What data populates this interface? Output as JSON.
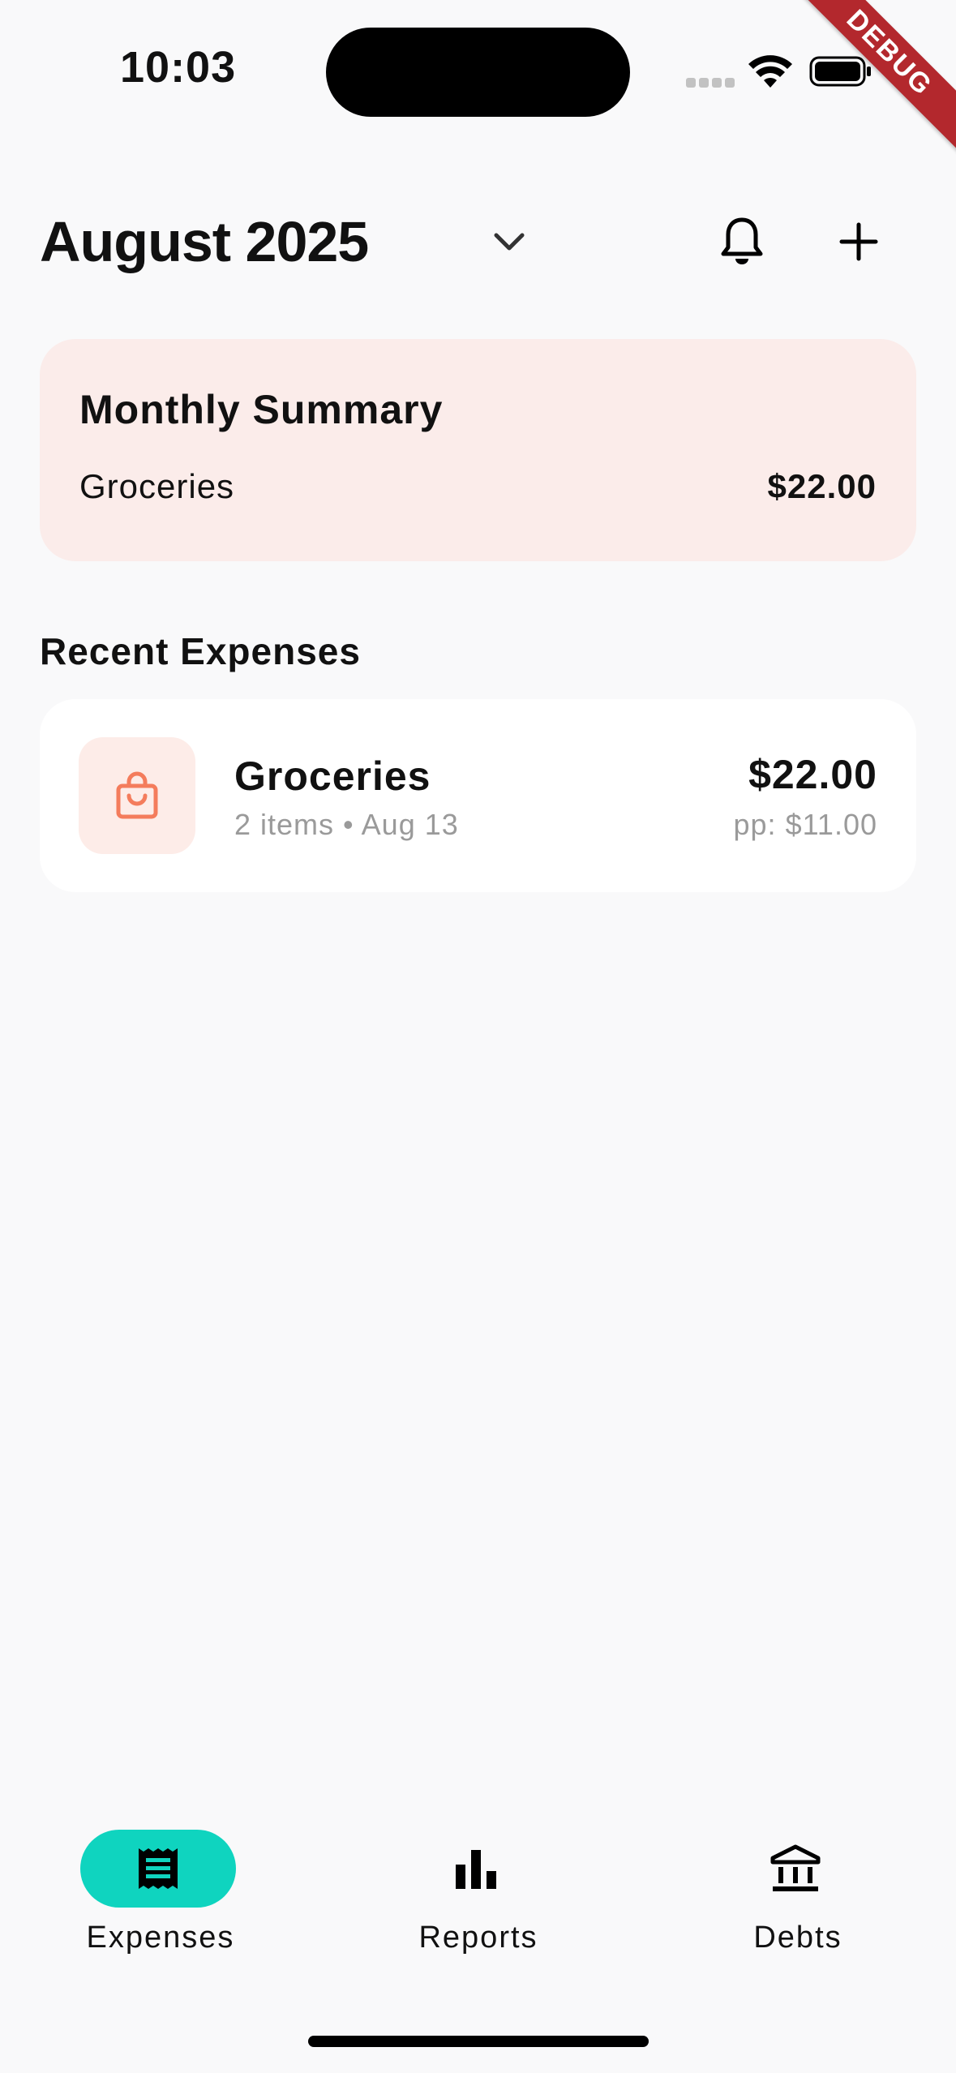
{
  "status_bar": {
    "time": "10:03"
  },
  "debug_banner": "DEBUG",
  "header": {
    "month": "August 2025",
    "icons": [
      "chevron-down-icon",
      "bell-icon",
      "plus-icon"
    ]
  },
  "summary": {
    "title": "Monthly Summary",
    "rows": [
      {
        "label": "Groceries",
        "amount": "$22.00"
      }
    ]
  },
  "recent": {
    "heading": "Recent Expenses",
    "items": [
      {
        "icon": "shopping-bag-icon",
        "name": "Groceries",
        "meta": "2 items • Aug 13",
        "amount": "$22.00",
        "per_person": "pp: $11.00"
      }
    ]
  },
  "nav": {
    "items": [
      {
        "label": "Expenses",
        "icon": "receipt-icon",
        "active": true
      },
      {
        "label": "Reports",
        "icon": "bar-chart-icon",
        "active": false
      },
      {
        "label": "Debts",
        "icon": "bank-icon",
        "active": false
      }
    ]
  },
  "colors": {
    "accent": "#0fd4bf",
    "summary_bg": "#fbecea",
    "icon_orange": "#f47c5c",
    "debug_red": "#b3282d"
  }
}
